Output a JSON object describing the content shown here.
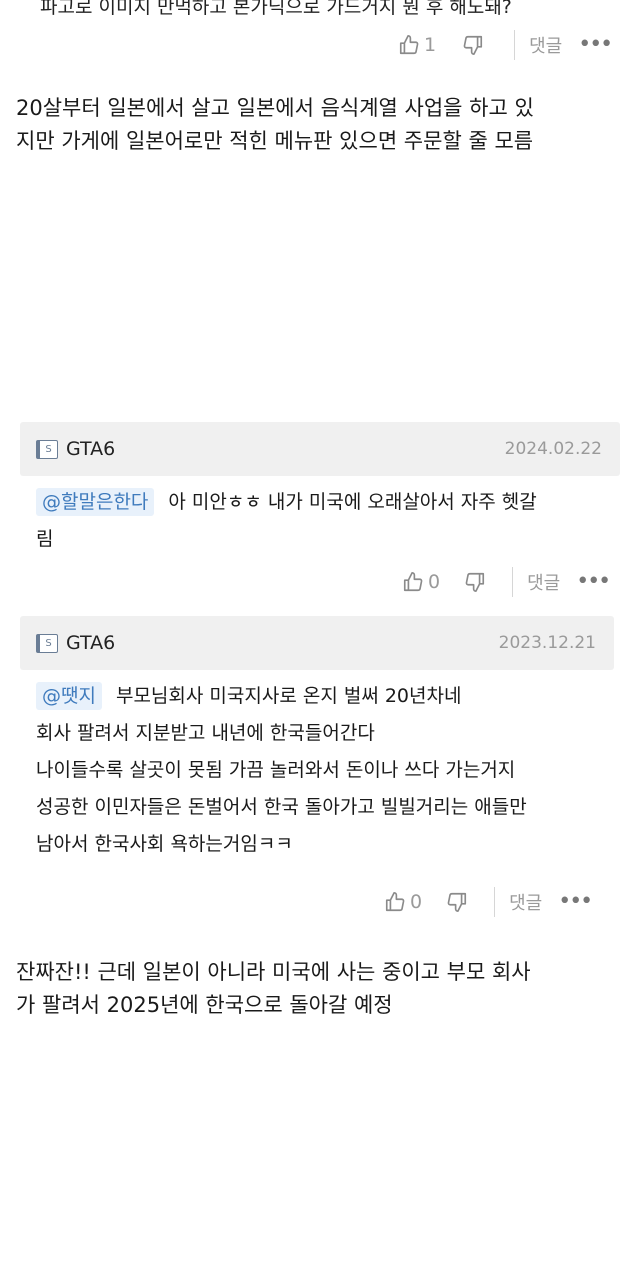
{
  "top_cutoff_text": "파고로 이미지 만먹하고 본가딕으로 가드거지 뭔 후 해도돼?",
  "comments_top": {
    "like_count": "1",
    "reply_label": "댓글"
  },
  "post_paragraph_1": {
    "lines": [
      "20살부터 일본에서 살고 일본에서 음식계열 사업을 하고 있",
      "지만 가게에 일본어로만 적힌 메뉴판 있으면 주문할 줄 모름"
    ]
  },
  "comment_1": {
    "username": "GTA6",
    "date": "2024.02.22",
    "mention": "@할말은한다",
    "lines": [
      "아 미안ㅎㅎ 내가 미국에 오래살아서 자주 헷갈",
      "림"
    ],
    "like_count": "0",
    "reply_label": "댓글"
  },
  "comment_2": {
    "username": "GTA6",
    "date": "2023.12.21",
    "mention": "@땟지",
    "lines": [
      "부모님회사 미국지사로 온지 벌써 20년차네",
      "회사 팔려서 지분받고 내년에 한국들어간다",
      "나이들수록 살곳이 못됨 가끔 놀러와서 돈이나 쓰다 가는거지",
      "성공한 이민자들은 돈벌어서 한국 돌아가고 빌빌거리는 애들만",
      "남아서 한국사회 욕하는거임ㅋㅋ"
    ],
    "like_count": "0",
    "reply_label": "댓글"
  },
  "post_paragraph_2": {
    "lines": [
      "잔짜잔!! 근데 일본이 아니라 미국에 사는 중이고 부모 회사",
      "가 팔려서 2025년에 한국으로 돌아갈 예정"
    ]
  },
  "icons": {
    "like": "thumbs-up-icon",
    "dislike": "thumbs-down-icon",
    "more": "more-dots-icon",
    "badge": "s-badge-icon"
  },
  "colors": {
    "comment_header_bg": "#f0f0f0",
    "mention_bg": "#e8f1fb",
    "mention_text": "#3f7bbd",
    "muted_text": "#9a9a9a"
  }
}
